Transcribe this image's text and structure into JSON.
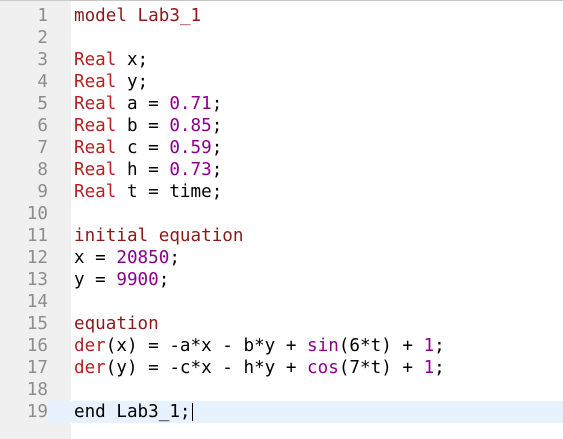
{
  "editor": {
    "current_line": 19,
    "lines": [
      {
        "n": "1",
        "tokens": [
          {
            "t": "model Lab3_1",
            "c": "kwb"
          }
        ]
      },
      {
        "n": "2",
        "tokens": []
      },
      {
        "n": "3",
        "tokens": [
          {
            "t": "Real",
            "c": "kw"
          },
          {
            "t": " x;",
            "c": ""
          }
        ]
      },
      {
        "n": "4",
        "tokens": [
          {
            "t": "Real",
            "c": "kw"
          },
          {
            "t": " y;",
            "c": ""
          }
        ]
      },
      {
        "n": "5",
        "tokens": [
          {
            "t": "Real",
            "c": "kw"
          },
          {
            "t": " a = ",
            "c": ""
          },
          {
            "t": "0.71",
            "c": "num"
          },
          {
            "t": ";",
            "c": ""
          }
        ]
      },
      {
        "n": "6",
        "tokens": [
          {
            "t": "Real",
            "c": "kw"
          },
          {
            "t": " b = ",
            "c": ""
          },
          {
            "t": "0.85",
            "c": "num"
          },
          {
            "t": ";",
            "c": ""
          }
        ]
      },
      {
        "n": "7",
        "tokens": [
          {
            "t": "Real",
            "c": "kw"
          },
          {
            "t": " c = ",
            "c": ""
          },
          {
            "t": "0.59",
            "c": "num"
          },
          {
            "t": ";",
            "c": ""
          }
        ]
      },
      {
        "n": "8",
        "tokens": [
          {
            "t": "Real",
            "c": "kw"
          },
          {
            "t": " h = ",
            "c": ""
          },
          {
            "t": "0.73",
            "c": "num"
          },
          {
            "t": ";",
            "c": ""
          }
        ]
      },
      {
        "n": "9",
        "tokens": [
          {
            "t": "Real",
            "c": "kw"
          },
          {
            "t": " t = time;",
            "c": ""
          }
        ]
      },
      {
        "n": "10",
        "tokens": []
      },
      {
        "n": "11",
        "tokens": [
          {
            "t": "initial equation",
            "c": "kwb"
          }
        ]
      },
      {
        "n": "12",
        "tokens": [
          {
            "t": "x = ",
            "c": ""
          },
          {
            "t": "20850",
            "c": "num"
          },
          {
            "t": ";",
            "c": ""
          }
        ]
      },
      {
        "n": "13",
        "tokens": [
          {
            "t": "y = ",
            "c": ""
          },
          {
            "t": "9900",
            "c": "num"
          },
          {
            "t": ";",
            "c": ""
          }
        ]
      },
      {
        "n": "14",
        "tokens": []
      },
      {
        "n": "15",
        "tokens": [
          {
            "t": "equation",
            "c": "kwb"
          }
        ]
      },
      {
        "n": "16",
        "tokens": [
          {
            "t": "der",
            "c": "kw"
          },
          {
            "t": "(x) = -a*x - b*y + ",
            "c": ""
          },
          {
            "t": "sin",
            "c": "fn"
          },
          {
            "t": "(6*t) + ",
            "c": ""
          },
          {
            "t": "1",
            "c": "num"
          },
          {
            "t": ";",
            "c": ""
          }
        ]
      },
      {
        "n": "17",
        "tokens": [
          {
            "t": "der",
            "c": "kw"
          },
          {
            "t": "(y) = -c*x - h*y + ",
            "c": ""
          },
          {
            "t": "cos",
            "c": "fn"
          },
          {
            "t": "(7*t) + ",
            "c": ""
          },
          {
            "t": "1",
            "c": "num"
          },
          {
            "t": ";",
            "c": ""
          }
        ]
      },
      {
        "n": "18",
        "tokens": []
      },
      {
        "n": "19",
        "tokens": [
          {
            "t": "end Lab3_1;",
            "c": ""
          }
        ]
      }
    ]
  },
  "colors": {
    "keyword": "#b22222",
    "number": "#8b008b",
    "line_number": "#8c8c8c",
    "gutter_bg": "#f0f0f0",
    "current_line_bg": "#e8f2fe"
  }
}
